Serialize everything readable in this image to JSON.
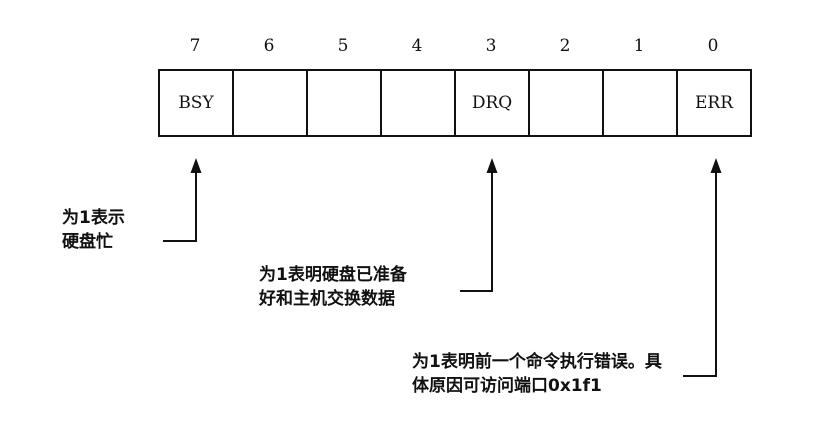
{
  "register": {
    "bit_numbers": [
      "7",
      "6",
      "5",
      "4",
      "3",
      "2",
      "1",
      "0"
    ],
    "bit_names": [
      "BSY",
      "",
      "",
      "",
      "DRQ",
      "",
      "",
      "ERR"
    ]
  },
  "annotations": {
    "bsy": {
      "line1": "为1表示",
      "line2": "硬盘忙"
    },
    "drq": {
      "line1": "为1表明硬盘已准备",
      "line2": "好和主机交换数据"
    },
    "err": {
      "line1": "为1表明前一个命令执行错误。具",
      "line2": "体原因可访问端口0x1f1"
    }
  }
}
